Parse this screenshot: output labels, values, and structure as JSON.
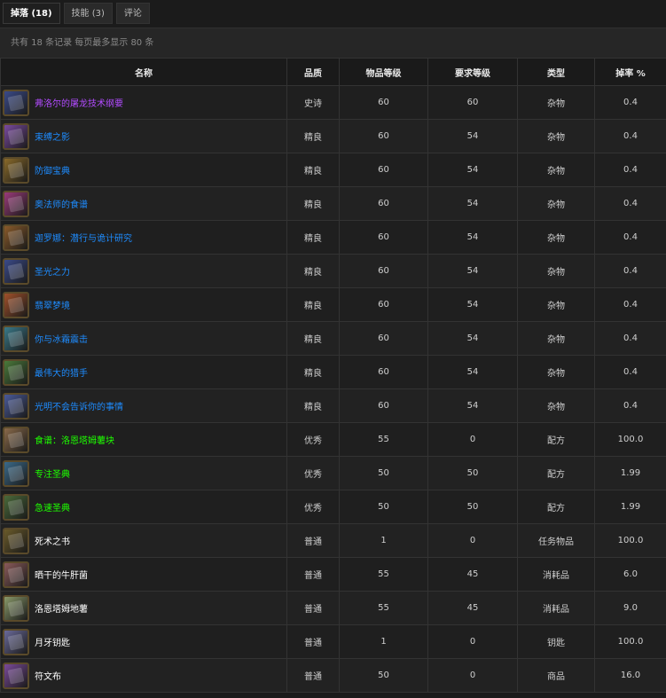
{
  "tabs": [
    {
      "label": "掉落 (18)",
      "active": true
    },
    {
      "label": "技能 (3)",
      "active": false
    },
    {
      "label": "评论",
      "active": false
    }
  ],
  "info": "共有 18 条记录 每页最多显示 80 条",
  "columns": [
    "名称",
    "品质",
    "物品等级",
    "要求等级",
    "类型",
    "掉率 %"
  ],
  "colors": {
    "epic": "#b24bff",
    "rare": "#1e8cff",
    "uncommon": "#1eff00",
    "common": "#ffffff",
    "background": "#1b1b1b"
  },
  "rows": [
    {
      "icon": "tome-icon",
      "icon_color": "#3a4a8a",
      "name": "弗洛尔的屠龙技术纲要",
      "q": "epic",
      "quality": "史诗",
      "ilvl": "60",
      "req": "60",
      "type": "杂物",
      "rate": "0.4"
    },
    {
      "icon": "tome-icon",
      "icon_color": "#7a4aa0",
      "name": "束缚之影",
      "q": "rare",
      "quality": "精良",
      "ilvl": "60",
      "req": "54",
      "type": "杂物",
      "rate": "0.4"
    },
    {
      "icon": "tome-icon",
      "icon_color": "#8a6a2a",
      "name": "防御宝典",
      "q": "rare",
      "quality": "精良",
      "ilvl": "60",
      "req": "54",
      "type": "杂物",
      "rate": "0.4"
    },
    {
      "icon": "tome-icon",
      "icon_color": "#9a3a7a",
      "name": "奥法师的食谱",
      "q": "rare",
      "quality": "精良",
      "ilvl": "60",
      "req": "54",
      "type": "杂物",
      "rate": "0.4"
    },
    {
      "icon": "tome-icon",
      "icon_color": "#8a5a2a",
      "name": "迦罗娜：潜行与诡计研究",
      "q": "rare",
      "quality": "精良",
      "ilvl": "60",
      "req": "54",
      "type": "杂物",
      "rate": "0.4"
    },
    {
      "icon": "tome-icon",
      "icon_color": "#3a4a8a",
      "name": "圣光之力",
      "q": "rare",
      "quality": "精良",
      "ilvl": "60",
      "req": "54",
      "type": "杂物",
      "rate": "0.4"
    },
    {
      "icon": "tome-icon",
      "icon_color": "#a0502a",
      "name": "翡翠梦境",
      "q": "rare",
      "quality": "精良",
      "ilvl": "60",
      "req": "54",
      "type": "杂物",
      "rate": "0.4"
    },
    {
      "icon": "tome-icon",
      "icon_color": "#3a7a8a",
      "name": "你与冰霜震击",
      "q": "rare",
      "quality": "精良",
      "ilvl": "60",
      "req": "54",
      "type": "杂物",
      "rate": "0.4"
    },
    {
      "icon": "tome-icon",
      "icon_color": "#4a7a3a",
      "name": "最伟大的猎手",
      "q": "rare",
      "quality": "精良",
      "ilvl": "60",
      "req": "54",
      "type": "杂物",
      "rate": "0.4"
    },
    {
      "icon": "tome-icon",
      "icon_color": "#4a5a9a",
      "name": "光明不会告诉你的事情",
      "q": "rare",
      "quality": "精良",
      "ilvl": "60",
      "req": "54",
      "type": "杂物",
      "rate": "0.4"
    },
    {
      "icon": "scroll-icon",
      "icon_color": "#8a6a4a",
      "name": "食谱：洛恩塔姆薯块",
      "q": "uncommon",
      "quality": "优秀",
      "ilvl": "55",
      "req": "0",
      "type": "配方",
      "rate": "100.0"
    },
    {
      "icon": "tome-icon",
      "icon_color": "#3a6a8a",
      "name": "专注圣典",
      "q": "uncommon",
      "quality": "优秀",
      "ilvl": "50",
      "req": "50",
      "type": "配方",
      "rate": "1.99"
    },
    {
      "icon": "tome-icon",
      "icon_color": "#4a6a3a",
      "name": "急速圣典",
      "q": "uncommon",
      "quality": "优秀",
      "ilvl": "50",
      "req": "50",
      "type": "配方",
      "rate": "1.99"
    },
    {
      "icon": "tome-icon",
      "icon_color": "#6a5a2a",
      "name": "死术之书",
      "q": "common",
      "quality": "普通",
      "ilvl": "1",
      "req": "0",
      "type": "任务物品",
      "rate": "100.0"
    },
    {
      "icon": "mushroom-icon",
      "icon_color": "#8a5a5a",
      "name": "晒干的牛肝菌",
      "q": "common",
      "quality": "普通",
      "ilvl": "55",
      "req": "45",
      "type": "消耗品",
      "rate": "6.0"
    },
    {
      "icon": "potato-icon",
      "icon_color": "#8a9a6a",
      "name": "洛恩塔姆地薯",
      "q": "common",
      "quality": "普通",
      "ilvl": "55",
      "req": "45",
      "type": "消耗品",
      "rate": "9.0"
    },
    {
      "icon": "key-icon",
      "icon_color": "#6a6a9a",
      "name": "月牙钥匙",
      "q": "common",
      "quality": "普通",
      "ilvl": "1",
      "req": "0",
      "type": "钥匙",
      "rate": "100.0"
    },
    {
      "icon": "cloth-icon",
      "icon_color": "#7a4a9a",
      "name": "符文布",
      "q": "common",
      "quality": "普通",
      "ilvl": "50",
      "req": "0",
      "type": "商品",
      "rate": "16.0"
    }
  ]
}
